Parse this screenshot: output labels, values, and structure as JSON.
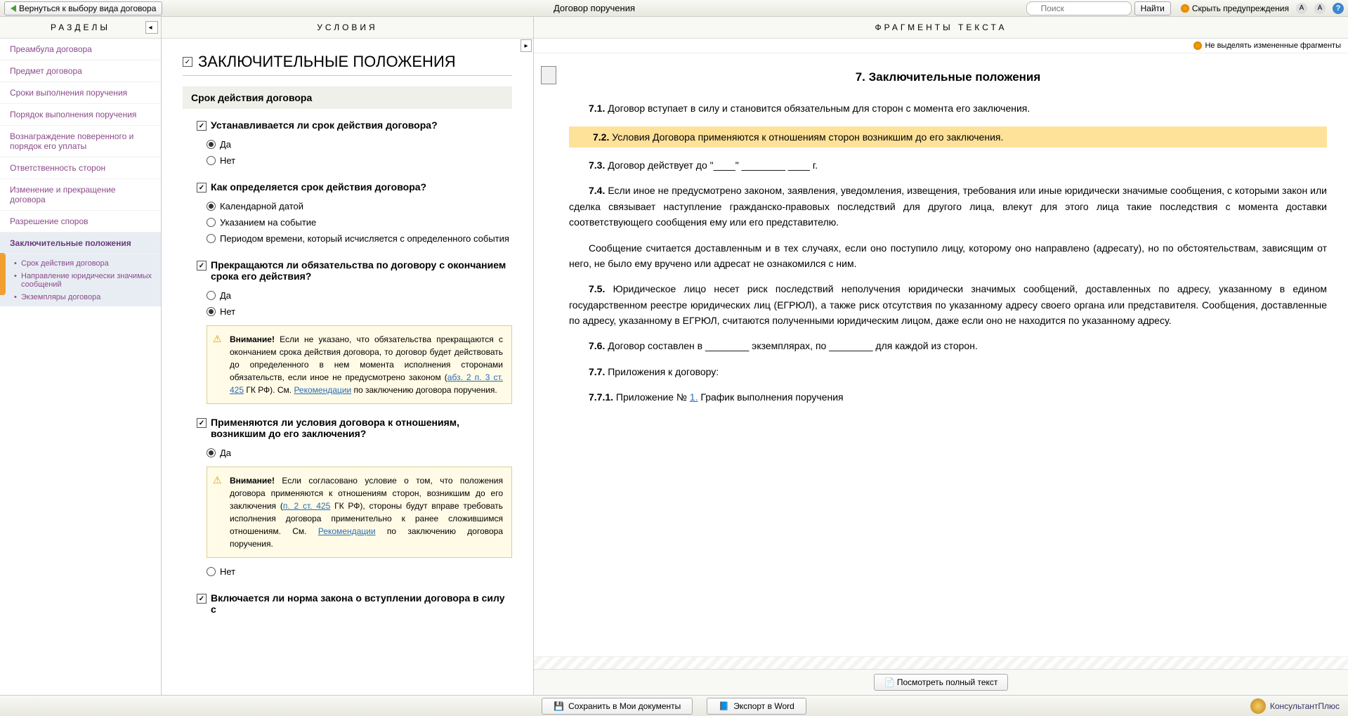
{
  "topbar": {
    "back": "Вернуться к выбору вида договора",
    "title": "Договор поручения",
    "search_placeholder": "Поиск",
    "find": "Найти",
    "hide_warnings": "Скрыть предупреждения"
  },
  "sidebar": {
    "header": "РАЗДЕЛЫ",
    "items": [
      "Преамбула договора",
      "Предмет договора",
      "Сроки выполнения поручения",
      "Порядок выполнения поручения",
      "Вознаграждение поверенного и порядок его уплаты",
      "Ответственность сторон",
      "Изменение и прекращение договора",
      "Разрешение споров",
      "Заключительные положения"
    ],
    "subs": [
      "Срок действия договора",
      "Направление юридически значимых сообщений",
      "Экземпляры договора"
    ]
  },
  "conditions": {
    "header": "УСЛОВИЯ",
    "section": "ЗАКЛЮЧИТЕЛЬНЫЕ ПОЛОЖЕНИЯ",
    "subsection": "Срок действия договора",
    "q1": {
      "title": "Устанавливается ли срок действия договора?",
      "o1": "Да",
      "o2": "Нет"
    },
    "q2": {
      "title": "Как определяется срок действия договора?",
      "o1": "Календарной датой",
      "o2": "Указанием на событие",
      "o3": "Периодом времени, который исчисляется с определенного события"
    },
    "q3": {
      "title": "Прекращаются ли обязательства по договору с окончанием срока его действия?",
      "o1": "Да",
      "o2": "Нет"
    },
    "warn1_b": "Внимание!",
    "warn1_t1": " Если не указано, что обязательства прекращаются с окончанием срока действия договора, то договор будет действовать до определенного в нем момента исполнения сторонами обязательств, если иное не предусмотрено законом (",
    "warn1_link1": "абз. 2 п. 3 ст. 425",
    "warn1_t2": " ГК РФ). См. ",
    "warn1_link2": "Рекомендации",
    "warn1_t3": " по заключению договора поручения.",
    "q4": {
      "title": "Применяются ли условия договора к отношениям, возникшим до его заключения?",
      "o1": "Да",
      "o2": "Нет"
    },
    "warn2_b": "Внимание!",
    "warn2_t1": " Если согласовано условие о том, что положения договора применяются к отношениям сторон, возникшим до его заключения (",
    "warn2_link1": "п. 2 ст. 425",
    "warn2_t2": " ГК РФ), стороны будут вправе требовать исполнения договора применительно к ранее сложившимся отношениям. См. ",
    "warn2_link2": "Рекомендации",
    "warn2_t3": " по заключению договора поручения.",
    "q5": {
      "title": "Включается ли норма закона о вступлении договора в силу с"
    }
  },
  "fragments": {
    "header": "ФРАГМЕНТЫ ТЕКСТА",
    "no_highlight": "Не выделять измененные фрагменты",
    "doc_title": "7. Заключительные положения",
    "p71n": "7.1.",
    "p71": " Договор вступает в силу и становится обязательным для сторон с момента его заключения.",
    "p72n": "7.2.",
    "p72": " Условия Договора применяются к отношениям сторон возникшим до его заключения.",
    "p73n": "7.3.",
    "p73": " Договор действует до \"____\" ________ ____ г.",
    "p74n": "7.4.",
    "p74": " Если иное не предусмотрено законом, заявления, уведомления, извещения, требования или иные юридически значимые сообщения, с которыми закон или сделка связывает наступление гражданско-правовых последствий для другого лица, влекут для этого лица такие последствия с момента доставки соответствующего сообщения ему или его представителю.",
    "p74b": "Сообщение считается доставленным и в тех случаях, если оно поступило лицу, которому оно направлено (адресату), но по обстоятельствам, зависящим от него, не было ему вручено или адресат не ознакомился с ним.",
    "p75n": "7.5.",
    "p75": " Юридическое лицо несет риск последствий неполучения юридически значимых сообщений, доставленных по адресу, указанному в едином государственном реестре юридических лиц (ЕГРЮЛ), а также риск отсутствия по указанному адресу своего органа или представителя. Сообщения, доставленные по адресу, указанному в ЕГРЮЛ, считаются полученными юридическим лицом, даже если оно не находится по указанному адресу.",
    "p76n": "7.6.",
    "p76": " Договор составлен в ________ экземплярах, по ________ для каждой из сторон.",
    "p77n": "7.7.",
    "p77": " Приложения к договору:",
    "p771n": "7.7.1.",
    "p771a": " Приложение № ",
    "p771link": "1.",
    "p771b": " График выполнения поручения",
    "full_text": "Посмотреть полный текст"
  },
  "bottom": {
    "save": "Сохранить в Мои документы",
    "export": "Экспорт в Word",
    "brand": "КонсультантПлюс"
  }
}
